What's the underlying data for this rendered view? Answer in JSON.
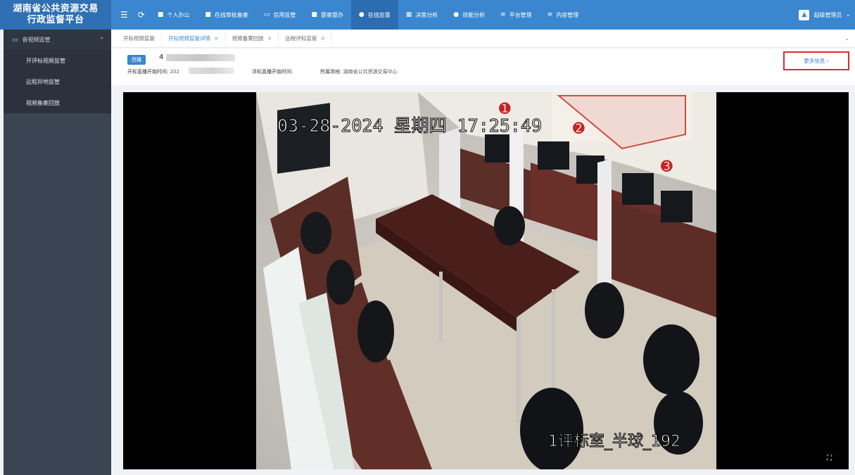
{
  "brand": {
    "line1": "湖南省公共资源交易",
    "line2": "行政监督平台"
  },
  "nav": {
    "menu_icon": "menu-icon",
    "refresh_icon": "refresh-icon",
    "items": [
      {
        "label": "个人办公",
        "icon": "briefcase-icon"
      },
      {
        "label": "在线审批备案",
        "icon": "approval-icon"
      },
      {
        "label": "信用监管",
        "icon": "card-icon"
      },
      {
        "label": "督察督办",
        "icon": "inspect-icon"
      },
      {
        "label": "在线监督",
        "icon": "monitor-icon"
      },
      {
        "label": "决策分析",
        "icon": "chart-icon"
      },
      {
        "label": "效能分析",
        "icon": "pie-icon"
      },
      {
        "label": "平台管理",
        "icon": "settings-icon"
      },
      {
        "label": "内容管理",
        "icon": "list-icon"
      }
    ],
    "active_index": 4
  },
  "user": {
    "name": "超级管理员"
  },
  "sidebar": {
    "section": "音视频监管",
    "items": [
      {
        "label": "开评标视频监管"
      },
      {
        "label": "远程异地监管"
      },
      {
        "label": "视频备案回放"
      }
    ]
  },
  "tabs": [
    {
      "label": "开标视频监管",
      "closable": false
    },
    {
      "label": "开标视频监管详情",
      "closable": true,
      "active": true
    },
    {
      "label": "视频备案回放",
      "closable": true
    },
    {
      "label": "远程评标监管",
      "closable": true
    }
  ],
  "info": {
    "tag": "西播",
    "project_prefix": "4",
    "open_label": "开标直播开始时间:",
    "open_value": "202",
    "eval_label": "评标直播开始时间:",
    "eval_value": "",
    "place_label": "所属场地:",
    "place_value": "湖南省公共资源交易中心",
    "more_button": "更多信息 ›"
  },
  "video": {
    "timestamp": "03-28-2024 星期四 17:25:49",
    "caption": "1评标室_半球_192",
    "markers": [
      "1",
      "2",
      "3"
    ]
  },
  "colors": {
    "topbar": "#3a86cf",
    "sidebar": "#3b4452",
    "highlight": "#e02a2a"
  }
}
